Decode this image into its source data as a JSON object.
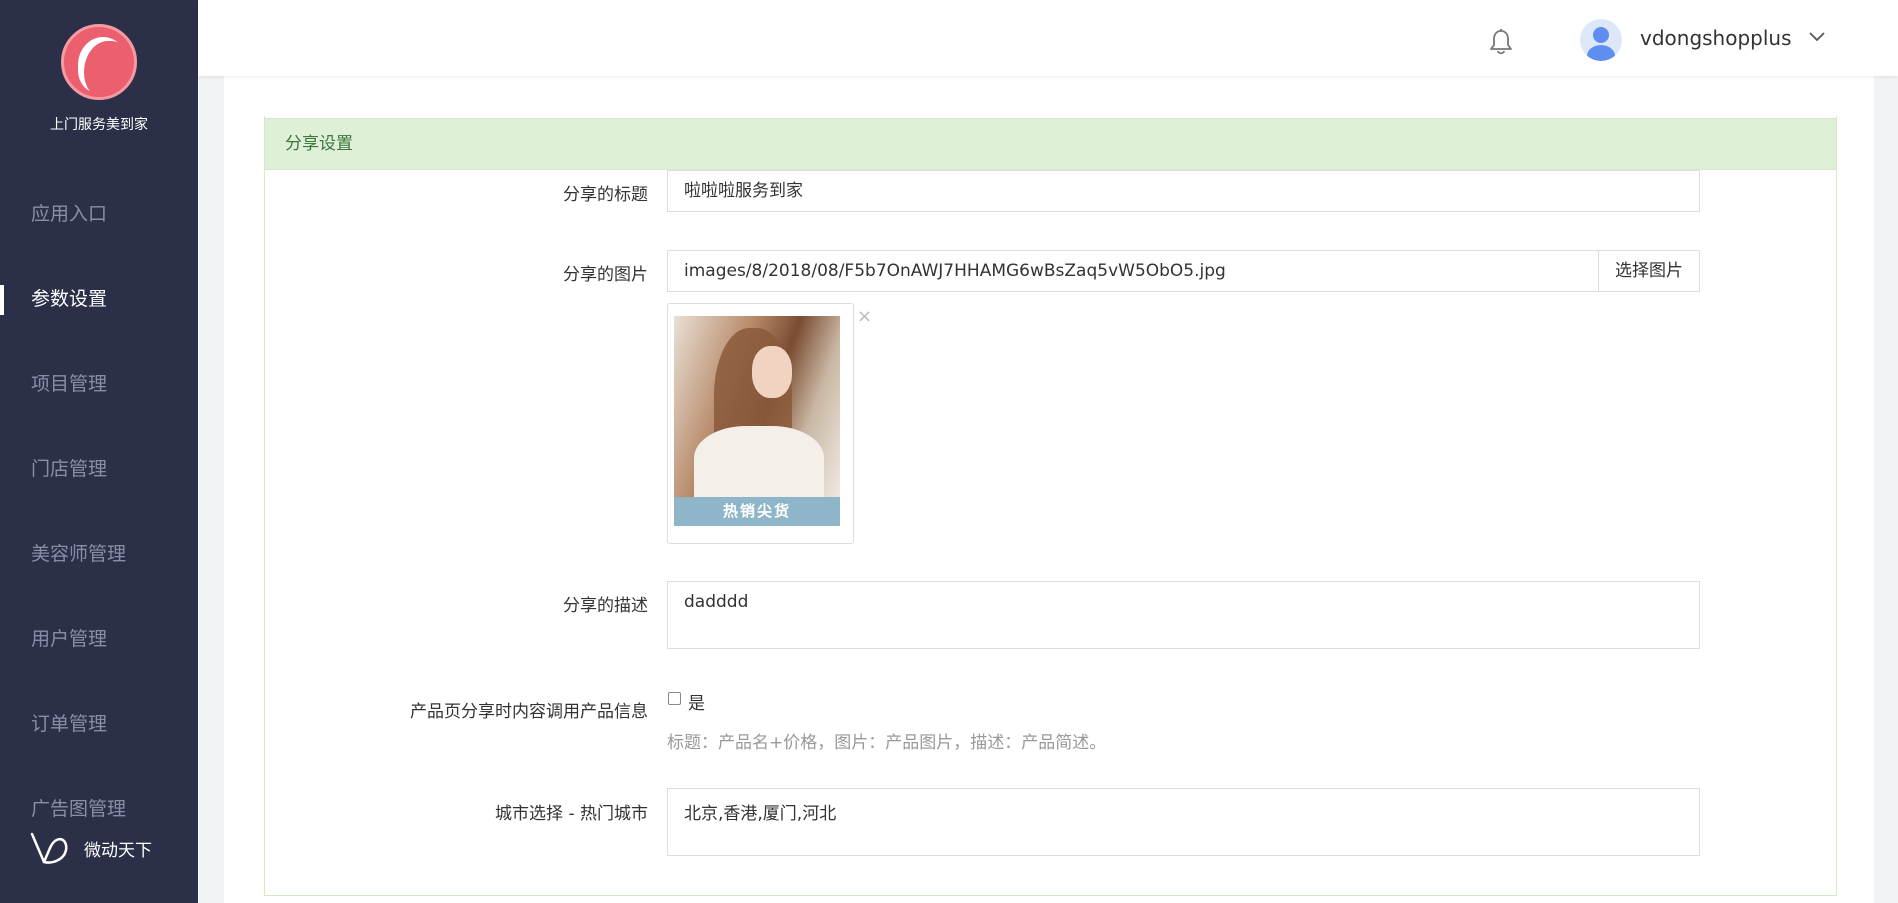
{
  "app": {
    "logo_text": "上门服务美到家",
    "brand_text": "微动天下"
  },
  "sidebar": {
    "items": [
      {
        "label": "应用入口",
        "active": false
      },
      {
        "label": "参数设置",
        "active": true
      },
      {
        "label": "项目管理",
        "active": false
      },
      {
        "label": "门店管理",
        "active": false
      },
      {
        "label": "美容师管理",
        "active": false
      },
      {
        "label": "用户管理",
        "active": false
      },
      {
        "label": "订单管理",
        "active": false
      },
      {
        "label": "广告图管理",
        "active": false
      }
    ]
  },
  "header": {
    "username": "vdongshopplus",
    "icons": [
      "bell-icon",
      "avatar",
      "chevron-down-icon"
    ]
  },
  "panel": {
    "title": "分享设置"
  },
  "form": {
    "share_title_label": "分享的标题",
    "share_title_value": "啦啦啦服务到家",
    "share_image_label": "分享的图片",
    "share_image_value": "images/8/2018/08/F5b7OnAWJ7HHAMG6wBsZaq5vW5ObO5.jpg",
    "pick_image_button": "选择图片",
    "image_banner_text": "热销尖货",
    "remove_icon": "×",
    "share_desc_label": "分享的描述",
    "share_desc_value": "dadddd",
    "product_share_label": "产品页分享时内容调用产品信息",
    "product_share_option": "是",
    "product_share_checked": false,
    "product_share_help": "标题：产品名+价格，图片：产品图片，描述：产品简述。",
    "hot_city_label": "城市选择 - 热门城市",
    "hot_city_value": "北京,香港,厦门,河北"
  },
  "colors": {
    "sidebar_bg": "#2c2f48",
    "panel_head_bg": "#dff0d8",
    "panel_head_text": "#3c763d",
    "accent_red": "#ec5f6e"
  }
}
